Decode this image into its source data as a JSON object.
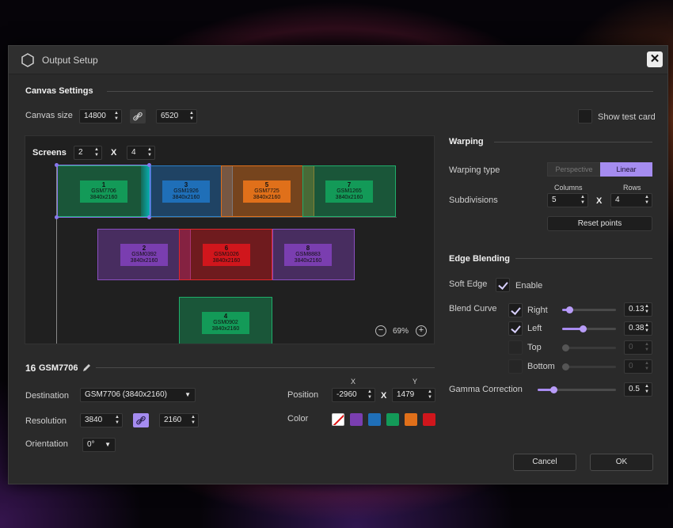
{
  "dialog": {
    "title": "Output Setup",
    "close": "✕"
  },
  "canvas_settings": {
    "title": "Canvas Settings",
    "size_label": "Canvas size",
    "width": "14800",
    "height": "6520",
    "show_test_card": "Show test card"
  },
  "screens": {
    "label": "Screens",
    "cols": "2",
    "x": "X",
    "rows": "4",
    "zoom": "69%",
    "items": [
      {
        "num": "1",
        "name": "GSM7706",
        "res": "3840x2160",
        "color": "#139a58"
      },
      {
        "num": "3",
        "name": "GSM1926",
        "res": "3840x2160",
        "color": "#1f6fb8"
      },
      {
        "num": "5",
        "name": "GSM7725",
        "res": "3840x2160",
        "color": "#e0701a"
      },
      {
        "num": "7",
        "name": "GSM1265",
        "res": "3840x2160",
        "color": "#139a58"
      },
      {
        "num": "2",
        "name": "GSM0392",
        "res": "3840x2160",
        "color": "#7a3eb0"
      },
      {
        "num": "6",
        "name": "GSM1026",
        "res": "3840x2160",
        "color": "#d0161c"
      },
      {
        "num": "8",
        "name": "GSM8883",
        "res": "3840x2160",
        "color": "#7a3eb0"
      },
      {
        "num": "4",
        "name": "GSM0902",
        "res": "3840x2160",
        "color": "#139a58"
      }
    ]
  },
  "screen_detail": {
    "number": "16",
    "name": "GSM7706",
    "destination_label": "Destination",
    "destination_value": "GSM7706 (3840x2160)",
    "resolution_label": "Resolution",
    "res_w": "3840",
    "res_h": "2160",
    "orientation_label": "Orientation",
    "orientation_value": "0°",
    "position_label": "Position",
    "pos_x_label": "X",
    "pos_y_label": "Y",
    "pos_x": "-2960",
    "pos_sep": "X",
    "pos_y": "1479",
    "color_label": "Color",
    "colors": [
      "#7a3eb0",
      "#1f6fb8",
      "#139a58",
      "#e0701a",
      "#d0161c"
    ]
  },
  "warping": {
    "title": "Warping",
    "type_label": "Warping type",
    "type_options": [
      "Perspective",
      "Linear"
    ],
    "subdivisions_label": "Subdivisions",
    "columns_label": "Columns",
    "rows_label": "Rows",
    "columns": "5",
    "sep": "X",
    "rows": "4",
    "reset": "Reset points"
  },
  "edge_blending": {
    "title": "Edge Blending",
    "soft_edge_label": "Soft Edge",
    "enable_label": "Enable",
    "blend_curve_label": "Blend Curve",
    "right_label": "Right",
    "right_value": "0.13",
    "right_level": 0.13,
    "left_label": "Left",
    "left_value": "0.38",
    "left_level": 0.38,
    "top_label": "Top",
    "top_value": "0",
    "bottom_label": "Bottom",
    "bottom_value": "0",
    "gamma_label": "Gamma Correction",
    "gamma_value": "0.5",
    "gamma_level": 0.2
  },
  "footer": {
    "cancel": "Cancel",
    "ok": "OK"
  },
  "accent": "#a58cf0"
}
